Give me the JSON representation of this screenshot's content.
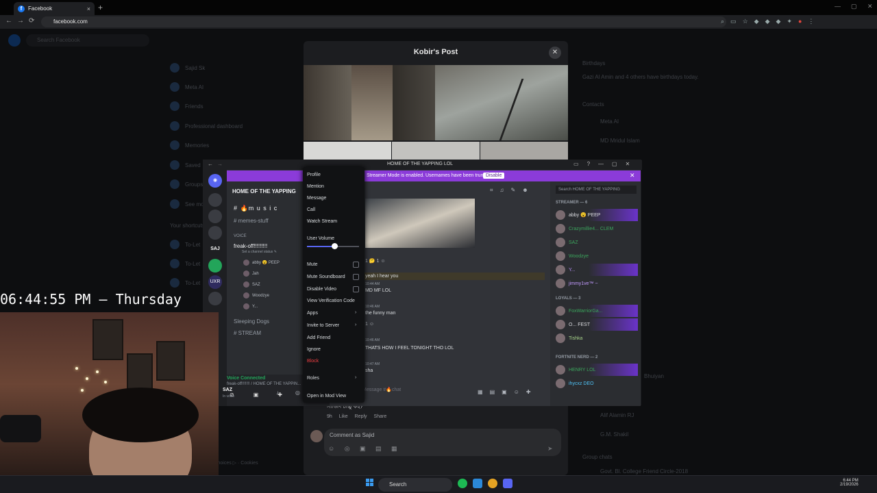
{
  "browser": {
    "tab_title": "Facebook",
    "tab_close": "×",
    "new_tab": "+",
    "url": "facebook.com",
    "nav": {
      "back": "←",
      "forward": "→",
      "reload": "⟳"
    },
    "window_controls": [
      "—",
      "▢",
      "✕"
    ]
  },
  "facebook": {
    "search_placeholder": "Search Facebook",
    "sidebar": [
      "Sajid Sk",
      "Meta AI",
      "Friends",
      "Professional dashboard",
      "Memories",
      "Saved",
      "Groups",
      "See more"
    ],
    "shortcuts_label": "Your shortcuts",
    "shortcuts": [
      "To-Let",
      "To-Let",
      "To-Let"
    ],
    "footer": "Privacy · Terms · Ad Choices ▷ · Cookies",
    "right": {
      "birthdays_label": "Birthdays",
      "birthdays_text": "Gazi Al Amin and 4 others have birthdays today.",
      "contacts_label": "Contacts",
      "contacts": [
        "Meta AI",
        "MD Mridul Islam"
      ],
      "lower_contacts": [
        "Bhuiyan",
        "Alif Alamin RJ",
        "G.M. Shakil"
      ],
      "group_chats_label": "Group chats",
      "group_chat": "Govt. Bl. College Friend Circle-2018"
    }
  },
  "post_modal": {
    "title": "Kobir's Post",
    "close": "✕",
    "comment_text": "সাজিদ চাচ্চু কই?",
    "comment_time": "9h",
    "comment_like": "Like",
    "comment_reply": "Reply",
    "comment_share": "Share",
    "comment_placeholder": "Comment as Sajid",
    "comment_tools": "☺ ◎ ▣ ▤ ▦",
    "send": "➤"
  },
  "discord": {
    "window_title": "HOME OF THE YAPPING LOL",
    "streamer_mode": "Streamer Mode is enabled. Usernames have been truncated.",
    "disable_button": "Disable",
    "banner_close": "✕",
    "server_name": "HOME OF THE YAPPING",
    "channels": [
      "# 🔥m u s i c",
      "# memes-stuff"
    ],
    "voice_header": "VOICE",
    "voice_channel": "freak-off!!!!!!!!!",
    "channel_status": "Set a channel status ✎",
    "voice_users": [
      "abby 😮 PEEP",
      "Jah",
      "SAZ",
      "Woodzye",
      "Y..."
    ],
    "other_voice": [
      "Sleeping Dogs",
      "# STREAM"
    ],
    "voice_connected": "Voice Connected",
    "voice_connected_sub": "freak-off!!!!!!! / HOME OF THE YAPPIN...",
    "user_name": "SAZ",
    "user_status": "In voice",
    "messages": [
      {
        "text": "yeah I hear you",
        "time": ""
      },
      {
        "text": "MD MF LOL",
        "time": "10:44 AM"
      },
      {
        "text": "the funny man",
        "time": "10:46 AM"
      },
      {
        "text": "THATS HOW I FEEL TONIGHT THO LOL",
        "time": "10:46 AM"
      },
      {
        "text": "sha",
        "time": "10:47 AM"
      }
    ],
    "input_placeholder": "Message #🔥chat",
    "member_search": "Search HOME OF THE YAPPING",
    "groups": [
      {
        "label": "STREAMER — 6",
        "members": [
          "abby 😮 PEEP",
          "Crazymillie4... CLEM",
          "SAZ",
          "Woodzye",
          "Y...",
          "jimmy1ve™ ~"
        ]
      },
      {
        "label": "LOYALS — 3",
        "members": [
          "FoxWarriorGa...",
          "O... FEST",
          "Tishka"
        ]
      },
      {
        "label": "FORTNITE NERD — 2",
        "members": [
          "HENRY LOL",
          "ihycxz DEO"
        ]
      }
    ]
  },
  "context_menu": {
    "items": [
      "Profile",
      "Mention",
      "Message",
      "Call",
      "Watch Stream"
    ],
    "user_volume": "User Volume",
    "volume_percent": 53,
    "toggles": [
      "Mute",
      "Mute Soundboard",
      "Disable Video"
    ],
    "verification": "View Verification Code",
    "apps": "Apps",
    "invite": "Invite to Server",
    "add_friend": "Add Friend",
    "ignore": "Ignore",
    "block": "Block",
    "roles": "Roles",
    "mod_view": "Open in Mod View",
    "arrow": "›"
  },
  "clock_overlay": "06:44:55 PM — Thursday",
  "taskbar": {
    "search": "Search",
    "time": "6:44 PM",
    "date": "2/19/2026"
  },
  "colors": {
    "discord_accent": "#5865f2",
    "streamer_banner": "#8b3bd9",
    "voice_green": "#23a55a",
    "danger": "#f23f43"
  }
}
